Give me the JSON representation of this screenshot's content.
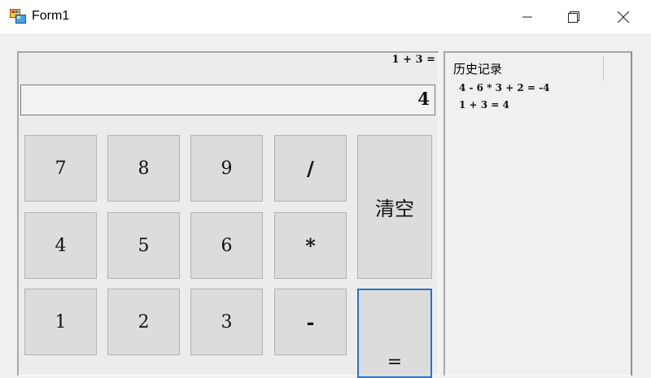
{
  "window": {
    "title": "Form1",
    "icon": "winforms-app-icon",
    "controls": [
      "minimize-icon",
      "maximize-icon",
      "close-icon"
    ]
  },
  "calculator": {
    "expression": "1 + 3 =",
    "display_value": "4",
    "keys": {
      "k7": "7",
      "k8": "8",
      "k9": "9",
      "div": "/",
      "k4": "4",
      "k5": "5",
      "k6": "6",
      "mul": "*",
      "k1": "1",
      "k2": "2",
      "k3": "3",
      "sub": "-",
      "clear": "清空",
      "equals": "="
    }
  },
  "history": {
    "title": "历史记录",
    "entries": [
      "4 - 6 * 3 + 2 = -4",
      "1 + 3 = 4"
    ]
  },
  "colors": {
    "focus_border": "#2a72c8",
    "key_face": "#dcdcdc",
    "window_bg": "#f0f0f0"
  }
}
